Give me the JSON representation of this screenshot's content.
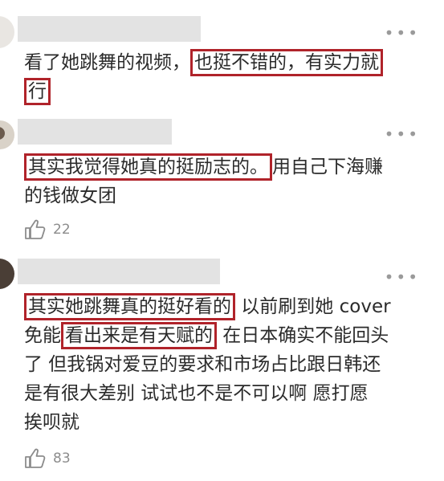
{
  "comments": [
    {
      "line1_plain": "看了她跳舞的视频，",
      "line1_hl": "也挺不错的，有实力就",
      "line2_hl": "行",
      "more": "•••"
    },
    {
      "line1_hl": "其实我觉得她真的挺励志的。",
      "line1_plain": "用自己下海赚",
      "line2_plain": "的钱做女团",
      "more": "•••",
      "likes": "22"
    },
    {
      "line1_hl": "其实她跳舞真的挺好看的",
      "line1_plain": " 以前刷到她 cover",
      "line2_prefix": "免能",
      "line2_hl": "看出来是有天赋的",
      "line2_plain": " 在日本确实不能回头",
      "line3": "了 但我锅对爱豆的要求和市场占比跟日韩还",
      "line4": "是有很大差别 试试也不是不可以啊  愿打愿",
      "line5": "挨呗就",
      "more": "•••",
      "likes": "83"
    }
  ],
  "colors": {
    "highlight_box": "#b0232a",
    "text": "#2b2b2b",
    "muted": "#8c8c8c",
    "redaction": "#e3e3e3"
  }
}
